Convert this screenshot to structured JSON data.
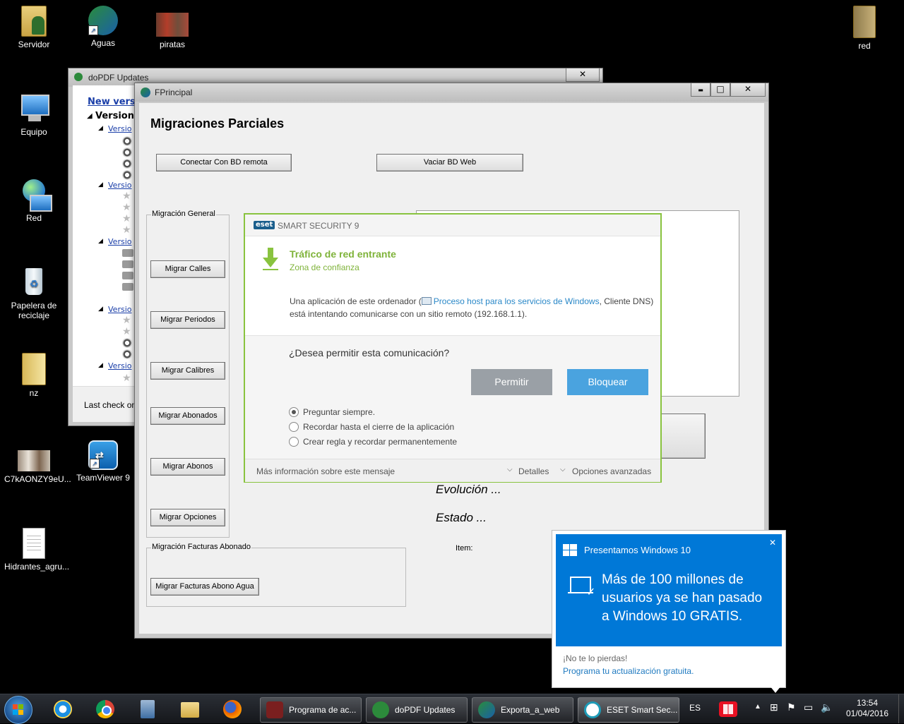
{
  "desktop": {
    "icons": [
      {
        "label": "Servidor"
      },
      {
        "label": "Aguas"
      },
      {
        "label": "piratas"
      },
      {
        "label": "red"
      },
      {
        "label": "Equipo"
      },
      {
        "label": "Red"
      },
      {
        "label": "Papelera de reciclaje"
      },
      {
        "label": "nz"
      },
      {
        "label": "C7kAONZY9eU..."
      },
      {
        "label": "TeamViewer 9"
      },
      {
        "label": "Hidrantes_agru..."
      }
    ]
  },
  "dopdf": {
    "title": "doPDF Updates",
    "close": "✕",
    "new_version": "New versi",
    "version_header": "Version",
    "version_item": "Versio",
    "last_check": "Last check on"
  },
  "fprincipal": {
    "title": "FPrincipal",
    "heading": "Migraciones Parciales",
    "connect_button": "Conectar Con BD remota",
    "empty_button": "Vaciar BD Web",
    "general_group": "Migración General",
    "general_buttons": [
      "Migrar Calles",
      "Migrar Periodos",
      "Migrar Calibres",
      "Migrar Abonados",
      "Migrar Abonos",
      "Migrar Opciones"
    ],
    "facturas_group": "Migración Facturas Abonado",
    "facturas_button": "Migrar Facturas Abono Agua",
    "evolucion": "Evolución ...",
    "estado": "Estado ...",
    "item_label": "Item:",
    "minimize": "▬",
    "maximize": "□",
    "close": "✕"
  },
  "eset": {
    "logo": "eset",
    "product": "SMART SECURITY 9",
    "alert_title": "Tráfico de red entrante",
    "alert_subtitle": "Zona de confianza",
    "desc_prefix": "Una aplicación de este ordenador (",
    "desc_link": "Proceso host para los servicios de Windows",
    "desc_suffix": ", Cliente DNS)",
    "desc_line2": "está intentando comunicarse con un sitio remoto (192.168.1.1).",
    "question": "¿Desea permitir esta comunicación?",
    "allow_button": "Permitir",
    "block_button": "Bloquear",
    "options": [
      "Preguntar siempre.",
      "Recordar hasta el cierre de la aplicación",
      "Crear regla y recordar permanentemente"
    ],
    "selected_option": 0,
    "more_info": "Más información sobre este mensaje",
    "details": "Detalles",
    "advanced": "Opciones avanzadas",
    "accent": "#89c33f",
    "button_blue": "#4aa3df"
  },
  "toast": {
    "title": "Presentamos Windows 10",
    "close": "✕",
    "message": "Más de 100 millones de usuarios ya se han pasado a Windows 10 GRATIS.",
    "footer_line1": "¡No te lo pierdas!",
    "footer_link": "Programa tu actualización gratuita.",
    "accent": "#0078d7"
  },
  "taskbar": {
    "items": [
      {
        "label": "Programa de ac..."
      },
      {
        "label": "doPDF Updates"
      },
      {
        "label": "Exporta_a_web"
      },
      {
        "label": "ESET Smart Sec..."
      }
    ],
    "language": "ES",
    "time": "13:54",
    "date": "01/04/2016"
  }
}
